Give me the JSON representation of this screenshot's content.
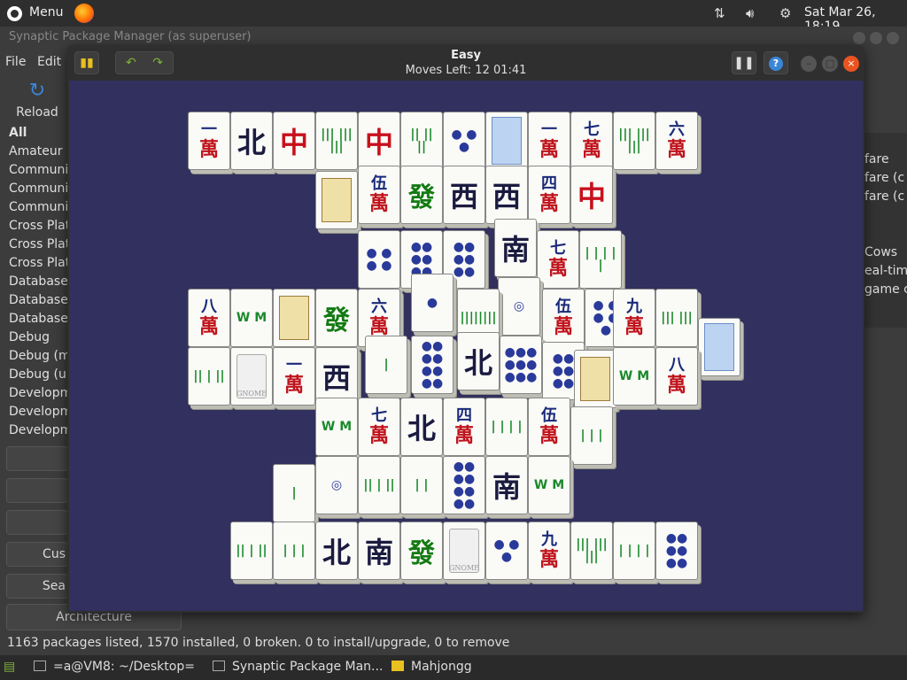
{
  "topbar": {
    "menu_label": "Menu",
    "clock": "Sat Mar 26, 18:19",
    "icons": [
      "ubuntu-logo-icon",
      "firefox-icon",
      "network-icon",
      "volume-icon",
      "settings-icon"
    ]
  },
  "synaptic": {
    "title": "Synaptic Package Manager  (as superuser)",
    "menu": [
      "File",
      "Edit"
    ],
    "reload_label": "Reload",
    "categories": [
      "All",
      "Amateur R",
      "Communic",
      "Communic",
      "Communic",
      "Cross Plat",
      "Cross Plat",
      "Cross Plat",
      "Databases",
      "Databases",
      "Databases",
      "Debug",
      "Debug (m",
      "Debug (ur",
      "Developm",
      "Developm",
      "Developm"
    ],
    "side_buttons": [
      "",
      "",
      "",
      "Cus",
      "Sea"
    ],
    "architecture_label": "Architecture",
    "right_list": [
      "fare",
      "fare (c",
      "fare (c",
      "Cows",
      "eal-tim",
      "game c"
    ],
    "status": "1163 packages listed, 1570 installed, 0 broken. 0 to install/upgrade, 0 to remove"
  },
  "mahjongg": {
    "title": "Easy",
    "subtitle": "Moves Left: 12   01:41",
    "tiles": [
      {
        "k": "wan",
        "n": "一"
      },
      {
        "k": "wind",
        "c": "北"
      },
      {
        "k": "red",
        "c": "中"
      },
      {
        "k": "bam",
        "c": "||| ||| |||"
      },
      {
        "k": "red",
        "c": "中"
      },
      {
        "k": "bam",
        "c": "|| || ||"
      },
      {
        "k": "dot",
        "c": "● ● ●"
      },
      {
        "k": "season"
      },
      {
        "k": "wan",
        "n": "一"
      },
      {
        "k": "wan",
        "n": "七"
      },
      {
        "k": "bam",
        "c": "||| ||| |||"
      },
      {
        "k": "wan",
        "n": "六"
      },
      {
        "k": "flower"
      },
      {
        "k": "wan",
        "n": "伍"
      },
      {
        "k": "green",
        "c": "發"
      },
      {
        "k": "wind",
        "c": "西"
      },
      {
        "k": "wind",
        "c": "西"
      },
      {
        "k": "wan",
        "n": "四"
      },
      {
        "k": "red",
        "c": "中"
      },
      {
        "k": "dot",
        "c": "● ● ● ●"
      },
      {
        "k": "dot",
        "c": "●● ●● ●●"
      },
      {
        "k": "dot",
        "c": "●● ●● ●●"
      },
      {
        "k": "wind",
        "c": "南"
      },
      {
        "k": "wan",
        "n": "七"
      },
      {
        "k": "bam",
        "c": "| | | | |"
      },
      {
        "k": "wan",
        "n": "八"
      },
      {
        "k": "bam",
        "c": "W M"
      },
      {
        "k": "flower"
      },
      {
        "k": "green",
        "c": "發"
      },
      {
        "k": "wan",
        "n": "六"
      },
      {
        "k": "dot",
        "c": "●"
      },
      {
        "k": "bam",
        "c": "||||||||"
      },
      {
        "k": "dot",
        "c": "◎"
      },
      {
        "k": "wan",
        "n": "伍"
      },
      {
        "k": "dot",
        "c": "● ● ● ● ●"
      },
      {
        "k": "wan",
        "n": "九"
      },
      {
        "k": "bam",
        "c": "||| |||"
      },
      {
        "k": "season"
      },
      {
        "k": "bam",
        "c": "|| | ||"
      },
      {
        "k": "gnome"
      },
      {
        "k": "wan",
        "n": "一"
      },
      {
        "k": "wind",
        "c": "西"
      },
      {
        "k": "bam",
        "c": "|"
      },
      {
        "k": "dot",
        "c": "●● ●● ●● ●●"
      },
      {
        "k": "wind",
        "c": "北"
      },
      {
        "k": "dot",
        "c": "●●● ●●● ●●●"
      },
      {
        "k": "dot",
        "c": "●● ●● ●●"
      },
      {
        "k": "flower"
      },
      {
        "k": "bam",
        "c": "W M"
      },
      {
        "k": "wan",
        "n": "八"
      },
      {
        "k": "bam",
        "c": "W M"
      },
      {
        "k": "wan",
        "n": "七"
      },
      {
        "k": "wind",
        "c": "北"
      },
      {
        "k": "wan",
        "n": "四"
      },
      {
        "k": "bam",
        "c": "| | | |"
      },
      {
        "k": "wan",
        "n": "伍"
      },
      {
        "k": "bam",
        "c": "| | |"
      },
      {
        "k": "bam",
        "c": "|"
      },
      {
        "k": "dot",
        "c": "◎"
      },
      {
        "k": "bam",
        "c": "|| | ||"
      },
      {
        "k": "bam",
        "c": "| |"
      },
      {
        "k": "dot",
        "c": "●● ●● ●● ●●"
      },
      {
        "k": "wind",
        "c": "南"
      },
      {
        "k": "bam",
        "c": "W M"
      },
      {
        "k": "bam",
        "c": "|| | ||"
      },
      {
        "k": "bam",
        "c": "| | |"
      },
      {
        "k": "wind",
        "c": "北"
      },
      {
        "k": "wind",
        "c": "南"
      },
      {
        "k": "green",
        "c": "發"
      },
      {
        "k": "gnome"
      },
      {
        "k": "dot",
        "c": "● ● ●"
      },
      {
        "k": "wan",
        "n": "九"
      },
      {
        "k": "bam",
        "c": "||| ||| |||"
      },
      {
        "k": "bam",
        "c": "| | | |"
      },
      {
        "k": "dot",
        "c": "●● ●● ●●"
      }
    ]
  },
  "taskbar": {
    "tasks": [
      "=a@VM8: ~/Desktop=",
      "Synaptic Package Man...",
      "Mahjongg"
    ]
  }
}
